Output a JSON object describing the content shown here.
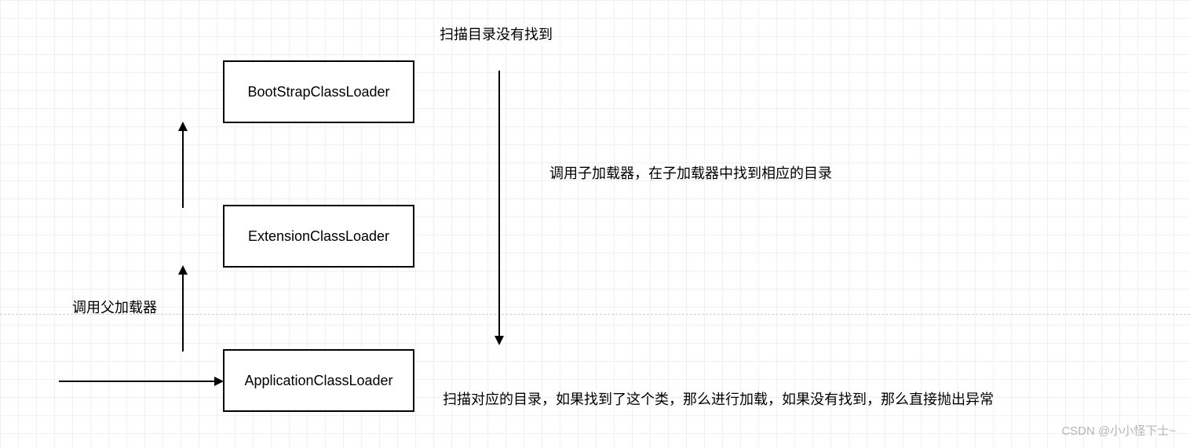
{
  "boxes": {
    "bootstrap": "BootStrapClassLoader",
    "extension": "ExtensionClassLoader",
    "application": "ApplicationClassLoader"
  },
  "labels": {
    "scan_not_found": "扫描目录没有找到",
    "call_child": "调用子加载器，在子加载器中找到相应的目录",
    "call_parent": "调用父加载器",
    "scan_result": "扫描对应的目录，如果找到了这个类，那么进行加载，如果没有找到，那么直接抛出异常"
  },
  "watermark": "CSDN @小小怪下士~"
}
